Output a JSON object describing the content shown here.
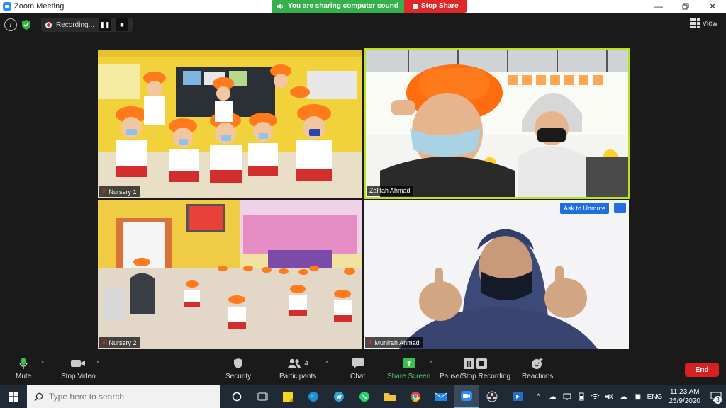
{
  "window": {
    "title": "Zoom Meeting",
    "share_banner": "You are sharing computer sound",
    "stop_share": "Stop Share"
  },
  "meeting": {
    "recording_label": "Recording...",
    "view_label": "View",
    "participants": [
      {
        "name": "Nursery 1",
        "muted": true
      },
      {
        "name": "Zalifah Ahmad",
        "muted": false,
        "active_speaker": true
      },
      {
        "name": "Nursery 2",
        "muted": true
      },
      {
        "name": "Munirah Ahmad",
        "muted": true
      }
    ],
    "ask_to_unmute": "Ask to Unmute",
    "more": "···"
  },
  "toolbar": {
    "mute": "Mute",
    "stop_video": "Stop Video",
    "security": "Security",
    "participants": "Participants",
    "participant_count": "4",
    "chat": "Chat",
    "share_screen": "Share Screen",
    "pause_recording": "Pause/Stop Recording",
    "reactions": "Reactions",
    "end": "End"
  },
  "taskbar": {
    "search_placeholder": "Type here to search",
    "language": "ENG",
    "time": "11:23 AM",
    "date": "25/9/2020",
    "notifications": "3"
  },
  "colors": {
    "accent_blue": "#1f6fe0",
    "share_green": "#35b04a",
    "stop_red": "#e02828",
    "active_speaker": "#b7e51b"
  }
}
